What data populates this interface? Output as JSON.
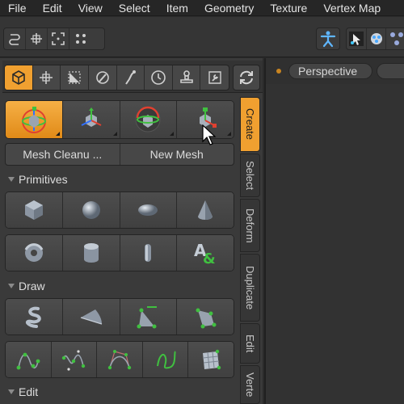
{
  "menu": [
    "File",
    "Edit",
    "View",
    "Select",
    "Item",
    "Geometry",
    "Texture",
    "Vertex Map"
  ],
  "colors": {
    "accent": "#f0a030",
    "panel": "#3a3a3a",
    "viewport": "#323232"
  },
  "toolbar": {
    "left_icons": [
      "snap-icon",
      "move-grid-icon",
      "frame-icon",
      "dots-icon"
    ],
    "right_icons": [
      "figure-icon",
      "select-arrow-icon",
      "paint-icon",
      "network-icon"
    ]
  },
  "category_tabs": [
    "cube-icon",
    "move-icon",
    "uv-icon",
    "sculpt-icon",
    "rig-icon",
    "clock-icon",
    "stamp-icon",
    "wrench-icon"
  ],
  "transform_tools": [
    "transform-icon",
    "move-tool-icon",
    "rotate-tool-icon",
    "scale-tool-icon"
  ],
  "buttons": {
    "mesh_cleanup": "Mesh Cleanu ...",
    "new_mesh": "New Mesh"
  },
  "sections": {
    "primitives": "Primitives",
    "draw": "Draw",
    "edit": "Edit"
  },
  "primitives_row1": [
    "cube-icon",
    "sphere-icon",
    "capsule-icon",
    "cone-icon"
  ],
  "primitives_row2": [
    "torus-icon",
    "cylinder-icon",
    "tube-icon",
    "text-icon"
  ],
  "draw_row1": [
    "curve-icon",
    "pen-icon",
    "polygon-icon",
    "bezier-polygon-icon"
  ],
  "draw_row2": [
    "spline-icon",
    "spline-points-icon",
    "bezier-icon",
    "sketch-icon",
    "patch-icon"
  ],
  "vertical_tabs": [
    "Create",
    "Select",
    "Deform",
    "Duplicate",
    "Edit",
    "Verte"
  ],
  "text_glyph": "A&",
  "viewport": {
    "label": "Perspective"
  }
}
